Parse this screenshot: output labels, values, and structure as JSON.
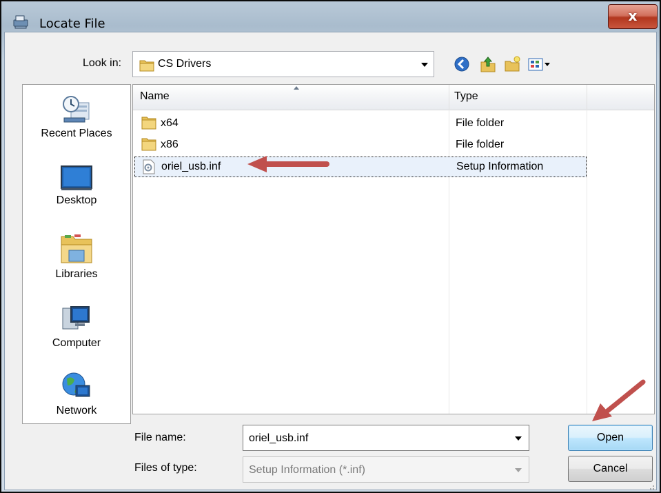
{
  "window": {
    "title": "Locate File",
    "close_glyph": "x"
  },
  "lookin": {
    "label": "Look in:",
    "value": "CS Drivers"
  },
  "toolbar": {
    "icons": [
      "back-icon",
      "up-folder-icon",
      "new-folder-icon",
      "view-menu-icon"
    ]
  },
  "places": [
    {
      "label": "Recent Places",
      "icon": "recent-places-icon"
    },
    {
      "label": "Desktop",
      "icon": "desktop-icon"
    },
    {
      "label": "Libraries",
      "icon": "libraries-icon"
    },
    {
      "label": "Computer",
      "icon": "computer-icon"
    },
    {
      "label": "Network",
      "icon": "network-icon"
    }
  ],
  "filelist": {
    "columns": [
      "Name",
      "Type"
    ],
    "rows": [
      {
        "name": "x64",
        "type": "File folder",
        "icon": "folder-icon"
      },
      {
        "name": "x86",
        "type": "File folder",
        "icon": "folder-icon"
      },
      {
        "name": "oriel_usb.inf",
        "type": "Setup Information",
        "icon": "setup-file-icon",
        "selected": true
      }
    ]
  },
  "filename": {
    "label": "File name:",
    "value": "oriel_usb.inf"
  },
  "filetype": {
    "label": "Files of type:",
    "value": "Setup Information (*.inf)"
  },
  "buttons": {
    "open": "Open",
    "cancel": "Cancel"
  },
  "colors": {
    "annotation_arrow": "#c0504d",
    "selection": "#e9f1fb"
  }
}
